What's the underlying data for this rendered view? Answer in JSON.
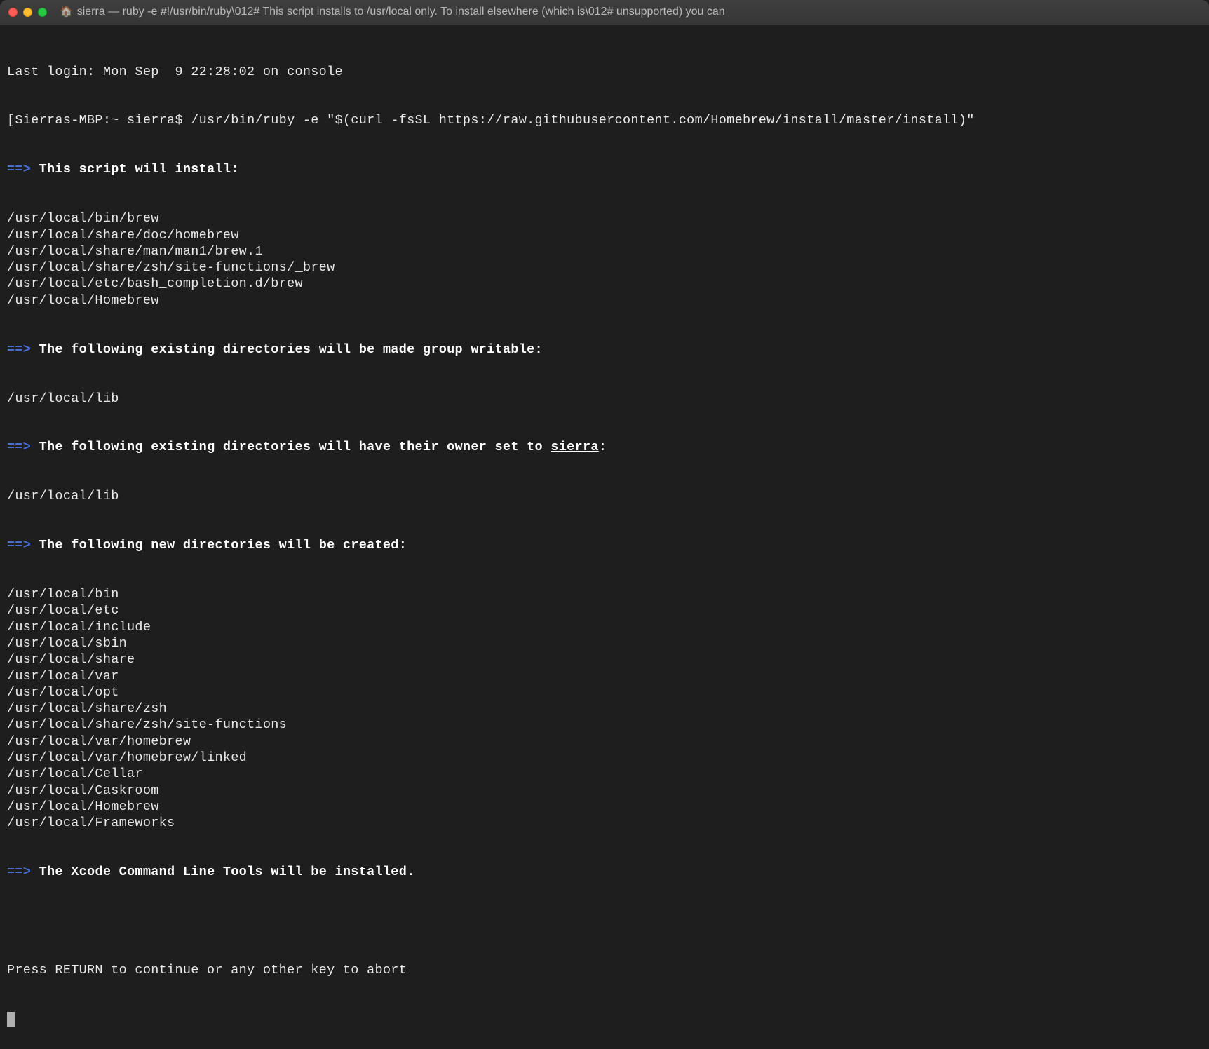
{
  "titlebar": {
    "title": "sierra — ruby -e #!/usr/bin/ruby\\012# This script installs to /usr/local only. To install elsewhere (which is\\012# unsupported) you can"
  },
  "terminal": {
    "last_login": "Last login: Mon Sep  9 22:28:02 on console",
    "prompt_open": "[",
    "prompt_host": "Sierras-MBP:~ sierra$ ",
    "command": "/usr/bin/ruby -e \"$(curl -fsSL https://raw.githubusercontent.com/Homebrew/install/master/install)\"",
    "arrow": "==>",
    "header_install": "This script will install:",
    "install_paths": [
      "/usr/local/bin/brew",
      "/usr/local/share/doc/homebrew",
      "/usr/local/share/man/man1/brew.1",
      "/usr/local/share/zsh/site-functions/_brew",
      "/usr/local/etc/bash_completion.d/brew",
      "/usr/local/Homebrew"
    ],
    "header_writable": "The following existing directories will be made group writable:",
    "writable_paths": [
      "/usr/local/lib"
    ],
    "header_owner_prefix": "The following existing directories will have their owner set to ",
    "owner_user": "sierra",
    "header_owner_suffix": ":",
    "owner_paths": [
      "/usr/local/lib"
    ],
    "header_new": "The following new directories will be created:",
    "new_paths": [
      "/usr/local/bin",
      "/usr/local/etc",
      "/usr/local/include",
      "/usr/local/sbin",
      "/usr/local/share",
      "/usr/local/var",
      "/usr/local/opt",
      "/usr/local/share/zsh",
      "/usr/local/share/zsh/site-functions",
      "/usr/local/var/homebrew",
      "/usr/local/var/homebrew/linked",
      "/usr/local/Cellar",
      "/usr/local/Caskroom",
      "/usr/local/Homebrew",
      "/usr/local/Frameworks"
    ],
    "header_xcode": "The Xcode Command Line Tools will be installed.",
    "press_return": "Press RETURN to continue or any other key to abort"
  }
}
